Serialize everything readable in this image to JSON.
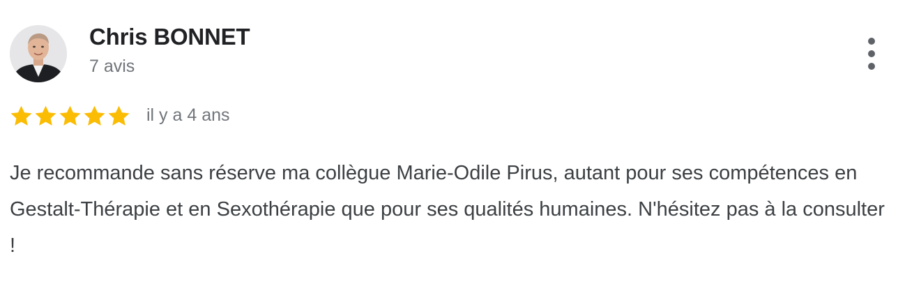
{
  "review": {
    "author": {
      "name": "Chris BONNET",
      "review_count": "7 avis",
      "avatar_icon": "user-avatar-photo"
    },
    "menu_icon": "more-vertical-icon",
    "rating": {
      "stars": 5,
      "max": 5,
      "star_color": "#fbbc04"
    },
    "date": "il y a 4 ans",
    "text": "Je recommande sans réserve ma collègue Marie-Odile Pirus, autant pour ses compétences en Gestalt-Thérapie et en Sexothérapie que pour ses qualités humaines. N'hésitez pas à la consulter !"
  }
}
